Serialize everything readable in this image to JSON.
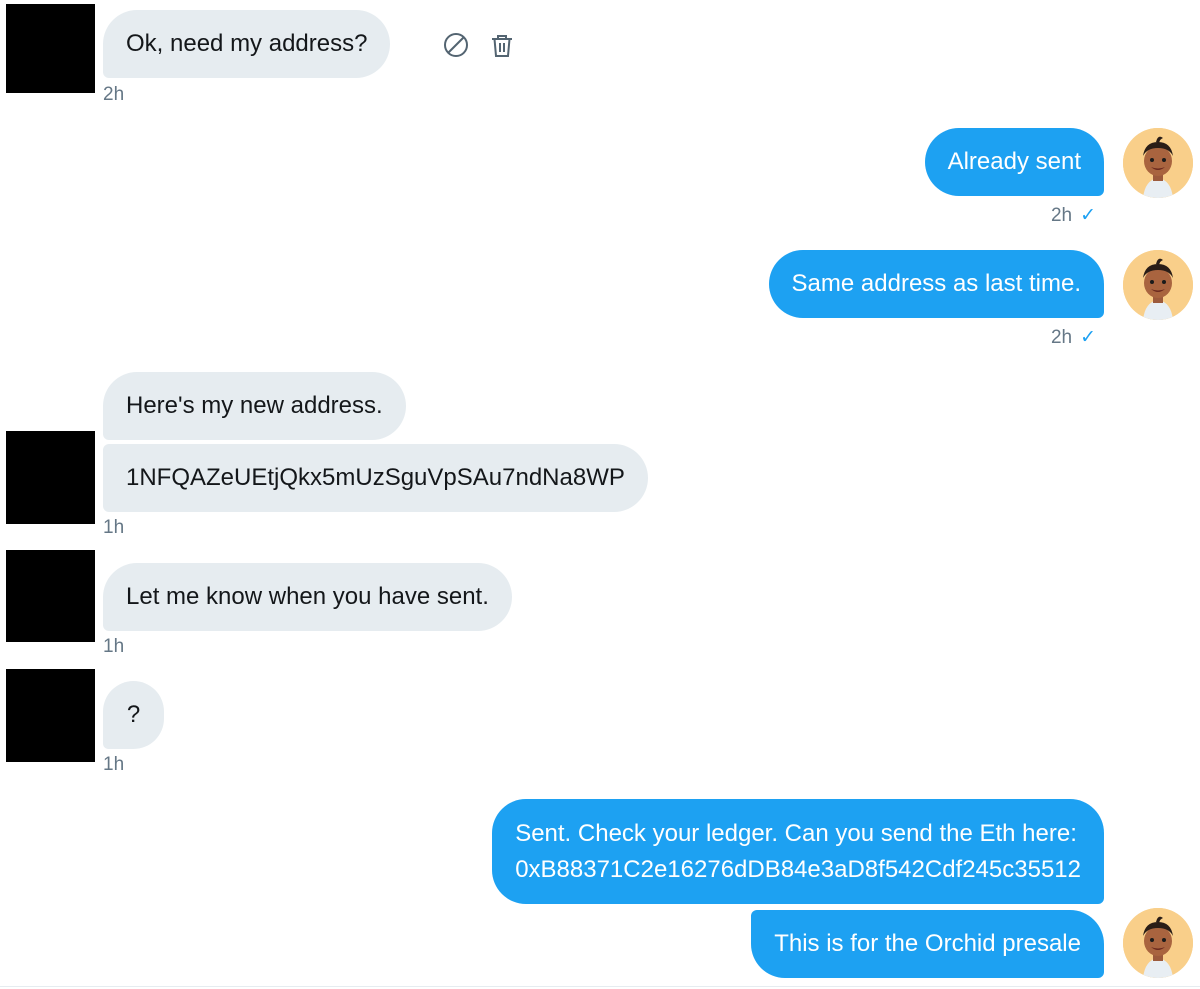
{
  "conversation": {
    "messages": [
      {
        "id": "m1",
        "direction": "in",
        "text": "Ok, need my address?",
        "time": "2h"
      },
      {
        "id": "m2",
        "direction": "out",
        "text": "Already sent",
        "time": "2h"
      },
      {
        "id": "m3",
        "direction": "out",
        "text": "Same address as last time.",
        "time": "2h"
      },
      {
        "id": "m4",
        "direction": "in",
        "text": "Here's my new address."
      },
      {
        "id": "m5",
        "direction": "in",
        "text": "1NFQAZeUEtjQkx5mUzSguVpSAu7ndNa8WP",
        "time": "1h"
      },
      {
        "id": "m6",
        "direction": "in",
        "text": "Let me know when you have sent.",
        "time": "1h"
      },
      {
        "id": "m7",
        "direction": "in",
        "text": "?",
        "time": "1h"
      },
      {
        "id": "m8",
        "direction": "out",
        "lines": [
          "Sent. Check your ledger. Can you send the Eth here:",
          "0xB88371C2e16276dDB84e3aD8f542Cdf245c35512"
        ]
      },
      {
        "id": "m9",
        "direction": "out",
        "text": "This is for the Orchid presale"
      }
    ],
    "read_receipt_icon": "checkmark-icon"
  },
  "message_actions": {
    "icons": [
      "block-icon",
      "trash-icon"
    ]
  },
  "colors": {
    "outgoing_bubble": "#1da1f2",
    "incoming_bubble": "#e6ecf0",
    "timestamp": "#657786",
    "avatar_background": "#f9cf8a"
  }
}
